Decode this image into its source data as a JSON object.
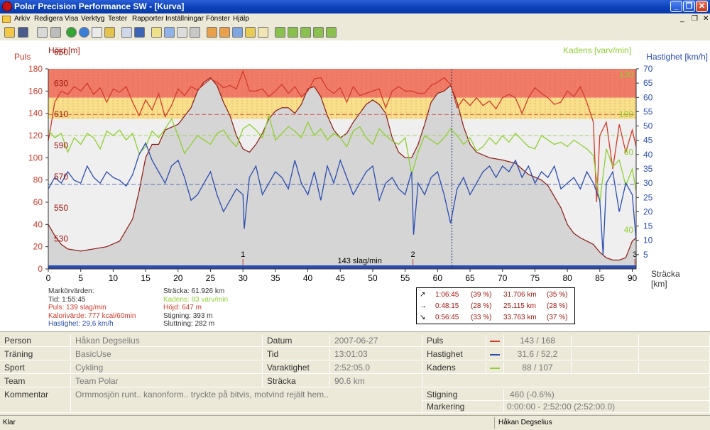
{
  "window": {
    "title": "Polar Precision Performance SW - [Kurva]",
    "buttons": [
      "_",
      "❐",
      "✕"
    ]
  },
  "menu": [
    "Arkiv",
    "Redigera",
    "Visa",
    "Verktyg",
    "Tester",
    "Rapporter",
    "Inställningar",
    "Fönster",
    "Hjälp"
  ],
  "mdi_buttons": [
    "_",
    "❐",
    "✕"
  ],
  "chart_data": {
    "type": "line",
    "xlabel": "Sträcka [km]",
    "x_ticks": [
      0,
      5,
      10,
      15,
      20,
      25,
      30,
      35,
      40,
      45,
      50,
      55,
      60,
      65,
      70,
      75,
      80,
      85,
      90
    ],
    "xlim": [
      0,
      90.6
    ],
    "y_left": {
      "label": "Puls",
      "lim": [
        0,
        180
      ],
      "ticks": [
        0,
        20,
        40,
        60,
        80,
        100,
        120,
        140,
        160,
        180
      ]
    },
    "y_alt": {
      "label": "Höjd [m]",
      "ticks": [
        530,
        550,
        570,
        590,
        610,
        630,
        650
      ],
      "positions_puls": [
        27,
        55,
        83,
        111,
        139,
        167,
        195
      ]
    },
    "y_right": {
      "label": "Hastighet [km/h]",
      "lim": [
        0,
        70
      ],
      "ticks": [
        5,
        10,
        15,
        20,
        25,
        30,
        35,
        40,
        45,
        50,
        55,
        60,
        65,
        70
      ]
    },
    "cadence_label": "Kadens [varv/min]",
    "cadence_ticks": [
      {
        "label": "40",
        "puls": 35
      },
      {
        "label": "60",
        "puls": 105
      },
      {
        "label": "100",
        "puls": 139
      },
      {
        "label": "120",
        "puls": 175
      }
    ],
    "zones": [
      {
        "from": 154,
        "to": 180,
        "color": "#f07c68"
      },
      {
        "from": 135,
        "to": 154,
        "color": "#f8df8a"
      },
      {
        "from": 0,
        "to": 135,
        "color": "#efefef"
      }
    ],
    "avg_lines": {
      "puls": 139,
      "kadens_puls": 120,
      "hastighet": 29.6
    },
    "series": [
      {
        "name": "Höjd",
        "color": "#8b1a10",
        "fill": "#d5d5d5",
        "x": [
          0,
          1,
          2,
          3,
          5,
          7,
          9,
          11,
          13,
          14,
          15,
          16,
          17,
          18,
          20,
          22,
          23,
          24,
          25,
          26,
          27,
          28,
          29,
          30,
          31,
          32,
          33,
          34,
          35,
          36,
          37,
          38,
          39,
          40,
          41,
          42,
          43,
          44,
          45,
          46,
          47,
          48,
          49,
          50,
          51,
          52,
          53,
          54,
          55,
          56,
          57,
          58,
          59,
          60,
          61,
          62,
          63,
          64,
          65,
          66,
          68,
          70,
          72,
          74,
          76,
          77,
          78,
          79,
          80,
          81,
          82,
          83,
          84,
          85,
          86,
          87,
          88,
          89,
          90,
          90.6
        ],
        "y": [
          40,
          30,
          22,
          18,
          16,
          18,
          20,
          25,
          45,
          70,
          100,
          112,
          112,
          125,
          130,
          145,
          160,
          168,
          172,
          165,
          150,
          138,
          120,
          108,
          105,
          112,
          122,
          135,
          142,
          145,
          145,
          140,
          148,
          162,
          164,
          155,
          138,
          125,
          118,
          122,
          132,
          140,
          148,
          152,
          148,
          140,
          118,
          105,
          100,
          100,
          112,
          130,
          150,
          158,
          160,
          165,
          150,
          128,
          112,
          105,
          100,
          98,
          95,
          85,
          80,
          75,
          65,
          55,
          40,
          32,
          28,
          25,
          22,
          15,
          10,
          8,
          8,
          10,
          25,
          28
        ]
      },
      {
        "name": "Puls",
        "color": "#d23a2a",
        "x": [
          0,
          0.5,
          1,
          2,
          3,
          4,
          5,
          6,
          7,
          8,
          9,
          10,
          11,
          12,
          13,
          14,
          15,
          16,
          17,
          18,
          19,
          20,
          21,
          22,
          23,
          24,
          25,
          26,
          27,
          28,
          29,
          30,
          31,
          32,
          33,
          34,
          35,
          36,
          37,
          38,
          39,
          40,
          41,
          42,
          43,
          44,
          45,
          46,
          47,
          48,
          49,
          50,
          51,
          52,
          53,
          54,
          55,
          56,
          57,
          58,
          59,
          60,
          61,
          62,
          63,
          64,
          65,
          66,
          67,
          68,
          69,
          70,
          71,
          72,
          73,
          74,
          75,
          76,
          77,
          78,
          79,
          80,
          81,
          82,
          83,
          84,
          84.5,
          85,
          86,
          87,
          88,
          89,
          90,
          90.6
        ],
        "y": [
          115,
          132,
          150,
          160,
          157,
          164,
          160,
          167,
          157,
          163,
          150,
          162,
          159,
          164,
          150,
          138,
          152,
          143,
          158,
          137,
          147,
          162,
          156,
          164,
          161,
          166,
          171,
          168,
          163,
          165,
          162,
          178,
          160,
          160,
          162,
          155,
          160,
          166,
          158,
          164,
          155,
          160,
          171,
          172,
          162,
          158,
          163,
          150,
          164,
          156,
          158,
          160,
          162,
          145,
          160,
          164,
          160,
          160,
          158,
          158,
          165,
          168,
          172,
          166,
          145,
          153,
          147,
          154,
          147,
          151,
          144,
          154,
          157,
          154,
          140,
          154,
          163,
          158,
          154,
          148,
          150,
          160,
          155,
          164,
          150,
          132,
          60,
          120,
          132,
          90,
          130,
          105,
          125,
          110
        ]
      },
      {
        "name": "Kadens",
        "color": "#8ed030",
        "x": [
          0,
          1,
          2,
          3,
          4,
          5,
          6,
          7,
          8,
          9,
          10,
          11,
          12,
          13,
          14,
          15,
          16,
          17,
          18,
          19,
          20,
          21,
          22,
          23,
          24,
          25,
          26,
          27,
          28,
          29,
          30,
          31,
          32,
          33,
          34,
          35,
          36,
          37,
          38,
          39,
          40,
          41,
          42,
          43,
          44,
          45,
          46,
          47,
          48,
          49,
          50,
          51,
          52,
          53,
          54,
          55,
          56,
          57,
          58,
          59,
          60,
          61,
          62,
          63,
          64,
          65,
          66,
          67,
          68,
          69,
          70,
          71,
          72,
          73,
          74,
          75,
          76,
          77,
          78,
          79,
          80,
          81,
          82,
          83,
          84,
          85,
          86,
          87,
          88,
          89,
          90,
          90.6
        ],
        "y": [
          125,
          118,
          122,
          105,
          118,
          112,
          122,
          118,
          108,
          124,
          120,
          125,
          116,
          122,
          104,
          110,
          124,
          118,
          126,
          135,
          120,
          104,
          112,
          120,
          116,
          112,
          122,
          125,
          116,
          110,
          126,
          130,
          125,
          118,
          138,
          116,
          122,
          128,
          124,
          118,
          132,
          120,
          126,
          116,
          122,
          118,
          110,
          124,
          128,
          118,
          112,
          126,
          120,
          115,
          112,
          118,
          85,
          105,
          120,
          116,
          112,
          118,
          126,
          120,
          112,
          118,
          106,
          110,
          118,
          112,
          120,
          114,
          122,
          116,
          110,
          108,
          120,
          116,
          112,
          114,
          110,
          116,
          112,
          108,
          102,
          60,
          108,
          92,
          98,
          75,
          90,
          70
        ]
      },
      {
        "name": "Hastighet",
        "color": "#2a4db0",
        "x": [
          0,
          1,
          2,
          3,
          4,
          5,
          6,
          7,
          8,
          9,
          10,
          11,
          12,
          13,
          14,
          15,
          16,
          17,
          18,
          19,
          20,
          21,
          22,
          23,
          24,
          25,
          26,
          27,
          28,
          29,
          30,
          30.2,
          31,
          32,
          33,
          34,
          35,
          36,
          37,
          38,
          39,
          40,
          41,
          42,
          43,
          44,
          45,
          46,
          47,
          48,
          49,
          50,
          51,
          52,
          53,
          54,
          55,
          56,
          56.3,
          57,
          58,
          59,
          60,
          61,
          62,
          63,
          64,
          65,
          66,
          67,
          68,
          69,
          70,
          71,
          72,
          73,
          74,
          75,
          76,
          77,
          78,
          79,
          80,
          81,
          82,
          83,
          84,
          85,
          85.5,
          86,
          87,
          88,
          89,
          90,
          90.6
        ],
        "y": [
          28,
          32,
          30,
          34,
          31,
          30,
          36,
          32,
          30,
          34,
          32,
          31,
          29,
          33,
          40,
          44,
          38,
          34,
          30,
          36,
          38,
          32,
          24,
          26,
          30,
          34,
          26,
          20,
          24,
          28,
          26,
          14,
          32,
          36,
          26,
          30,
          34,
          32,
          28,
          38,
          30,
          26,
          34,
          24,
          36,
          30,
          38,
          32,
          26,
          30,
          34,
          36,
          24,
          30,
          32,
          28,
          26,
          34,
          12,
          30,
          26,
          32,
          34,
          26,
          16,
          28,
          32,
          26,
          30,
          34,
          36,
          32,
          36,
          34,
          38,
          32,
          36,
          30,
          34,
          32,
          36,
          28,
          30,
          32,
          28,
          34,
          30,
          24,
          5,
          30,
          34,
          20,
          30,
          26,
          10
        ]
      }
    ],
    "markers": [
      {
        "label": "1",
        "x": 30
      },
      {
        "label": "2",
        "x": 56.2
      },
      {
        "label": "3",
        "x": 90.4
      }
    ],
    "bar_text": "143 slag/min",
    "cursor_x": 62.2,
    "marker_values": {
      "title": "Markörvärden:",
      "tid": "Tid: 1:55:45",
      "puls": "Puls: 139 slag/min",
      "kalori": "Kalorivärde: 777 kcal/60min",
      "hastighet": "Hastighet: 29,6 km/h",
      "stracka": "Sträcka: 61.926 km",
      "kadens": "Kadens: 83 varv/min",
      "hojd": "Höjd: 647 m",
      "stigning": "Stigning: 393 m",
      "sluttning": "Sluttning: 282 m"
    },
    "slope_box": [
      {
        "arrow": "↗",
        "time": "1:06:45",
        "tpct": "(39 %)",
        "km": "31.706 km",
        "kpct": "(35 %)"
      },
      {
        "arrow": "→",
        "time": "0:48:15",
        "tpct": "(28 %)",
        "km": "25.115 km",
        "kpct": "(28 %)"
      },
      {
        "arrow": "↘",
        "time": "0:56:45",
        "tpct": "(33 %)",
        "km": "33.763 km",
        "kpct": "(37 %)"
      }
    ]
  },
  "table": {
    "person_label": "Person",
    "person": "Håkan Degselius",
    "training_label": "Träning",
    "training": "BasicUse",
    "sport_label": "Sport",
    "sport": "Cykling",
    "team_label": "Team",
    "team": "Team Polar",
    "comment_label": "Kommentar",
    "comment": "Ormmosjön runt.. kanonform.. tryckte på bitvis, motvind rejält hem..",
    "date_label": "Datum",
    "date": "2007-06-27",
    "time_label": "Tid",
    "time": "13:01:03",
    "duration_label": "Varaktighet",
    "duration": "2:52:05.0",
    "distance_label": "Sträcka",
    "distance": "90.6 km",
    "pulse_label": "Puls",
    "pulse": "143 / 168",
    "speed_label": "Hastighet",
    "speed": "31,6 / 52,2",
    "cadence_label": "Kadens",
    "cadence": "88 / 107",
    "climb_label": "Stigning",
    "climb": "460 (-0.6%)",
    "mark_label": "Markering",
    "mark": "0:00:00 - 2:52:00 (2:52:00.0)",
    "pulse_color": "#d23a2a",
    "speed_color": "#2a4db0",
    "cadence_color": "#8ed030"
  },
  "status": {
    "left": "Klar",
    "right": "Håkan Degselius"
  }
}
